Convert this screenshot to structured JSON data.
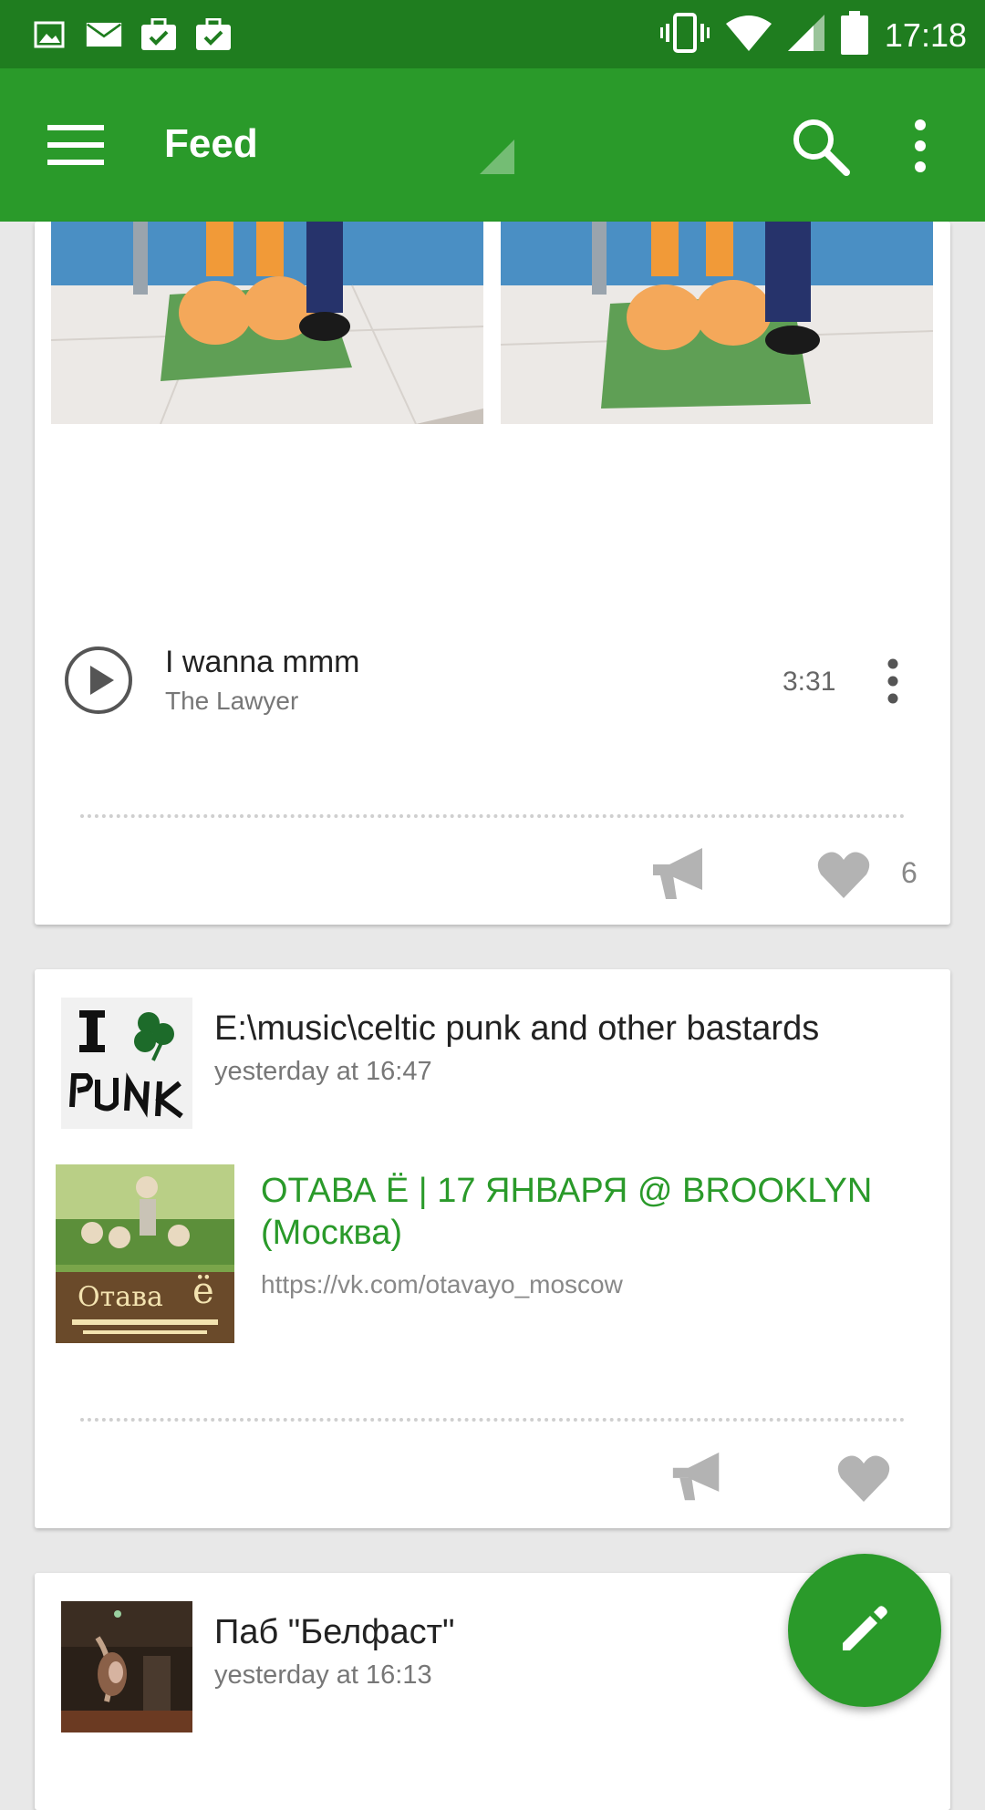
{
  "status_bar": {
    "time": "17:18",
    "left_icons": [
      "image-icon",
      "mail-icon",
      "briefcase-check-icon",
      "briefcase-check-icon"
    ],
    "right_icons": [
      "vibrate-icon",
      "wifi-icon",
      "signal-icon",
      "battery-icon"
    ]
  },
  "toolbar": {
    "title": "Feed",
    "menu_icon": "hamburger-menu-icon",
    "search_icon": "search-icon",
    "more_icon": "more-vert-icon"
  },
  "post1": {
    "audio": {
      "title": "I wanna mmm",
      "artist": "The Lawyer",
      "duration": "3:31"
    },
    "likes": "6"
  },
  "post2": {
    "title": "E:\\music\\celtic punk and other bastards",
    "time": "yesterday at 16:47",
    "link": {
      "title": "ОТАВА Ё | 17 ЯНВАРЯ @ BROOKLYN (Москва)",
      "url": "https://vk.com/otavayo_moscow"
    }
  },
  "post3": {
    "title": "Паб \"Белфаст\"",
    "time": "yesterday at 16:13"
  },
  "fab": {
    "icon": "pencil-icon"
  },
  "colors": {
    "status_bar": "#1f7d1f",
    "toolbar": "#2a9a2a",
    "accent": "#2a9a2a"
  }
}
